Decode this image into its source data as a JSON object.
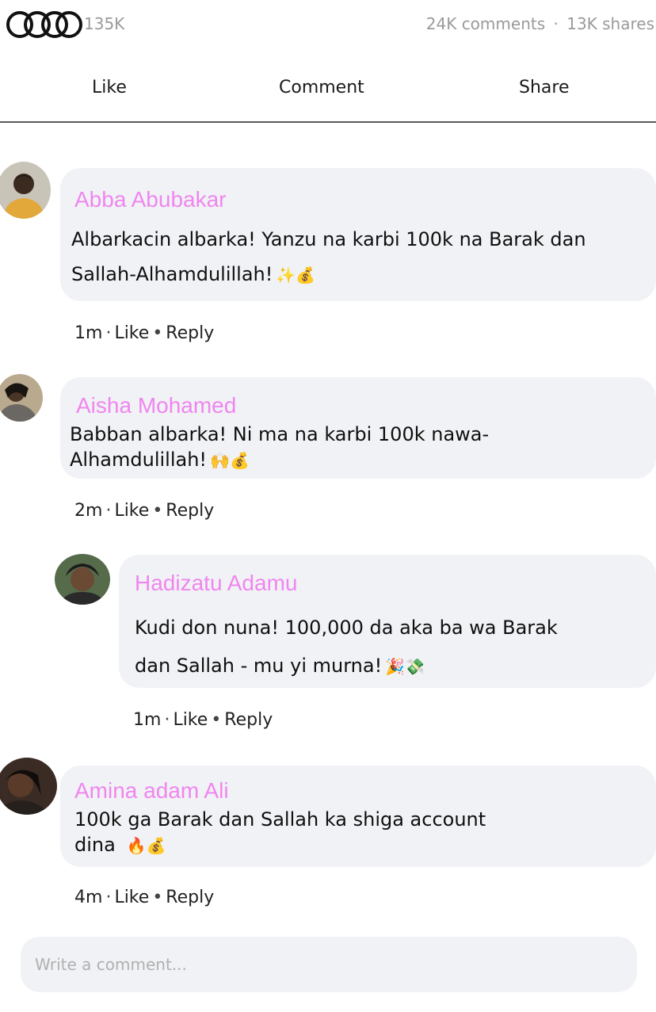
{
  "post_stats": {
    "reaction_count": "135K",
    "comments": "24K comments",
    "separator": "·",
    "shares": "13K shares",
    "reaction_icon": "four-rings-logo-icon"
  },
  "actions": {
    "like": "Like",
    "comment": "Comment",
    "share": "Share"
  },
  "comments": [
    {
      "author": "Abba Abubakar",
      "lines": [
        "Albarkacin albarka! Yanzu na karbi 100k na Barak dan",
        "Sallah-Alhamdulillah!"
      ],
      "emoji": "✨💰",
      "time": "1m",
      "like": "Like",
      "reply": "Reply",
      "avatar_icon": "avatar-abba-abubakar"
    },
    {
      "author": "Aisha Mohamed",
      "lines": [
        "Babban albarka! Ni ma na karbi 100k nawa-",
        "Alhamdulillah!"
      ],
      "emoji": "🙌💰",
      "time": "2m",
      "like": "Like",
      "reply": "Reply",
      "avatar_icon": "avatar-aisha-mohamed"
    },
    {
      "author": "Hadizatu Adamu",
      "lines": [
        "Kudi don nuna! 100,000 da aka ba wa Barak",
        "dan Sallah - mu yi murna!"
      ],
      "emoji": "🎉💸",
      "time": "1m",
      "like": "Like",
      "reply": "Reply",
      "avatar_icon": "avatar-hadizatu-adamu"
    },
    {
      "author": "Amina adam Ali",
      "lines": [
        "100k ga Barak dan Sallah ka shiga account",
        "dina"
      ],
      "emoji": "🔥💰",
      "time": "4m",
      "like": "Like",
      "reply": "Reply",
      "avatar_icon": "avatar-amina-adam-ali"
    }
  ],
  "composer": {
    "placeholder": "Write a comment..."
  },
  "colors": {
    "author_name": "#ef86ef",
    "bubble": "#f1f2f6",
    "muted": "#9a9a9a"
  }
}
